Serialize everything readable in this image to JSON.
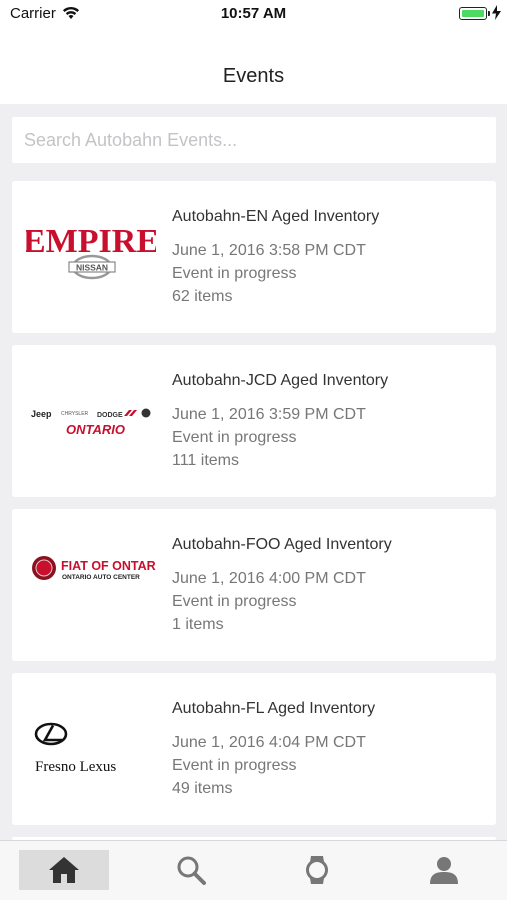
{
  "status": {
    "carrier": "Carrier",
    "time": "10:57 AM"
  },
  "header": {
    "title": "Events"
  },
  "search": {
    "placeholder": "Search Autobahn Events..."
  },
  "events": [
    {
      "title": "Autobahn-EN Aged Inventory",
      "date": "June 1, 2016 3:58 PM CDT",
      "status": "Event in progress",
      "count": "62 items",
      "logo": {
        "icon": "empire-nissan-logo",
        "text": "EMPIRE",
        "subtext": "NISSAN"
      }
    },
    {
      "title": "Autobahn-JCD Aged Inventory",
      "date": "June 1, 2016 3:59 PM CDT",
      "status": "Event in progress",
      "count": "111 items",
      "logo": {
        "icon": "jeep-chrysler-dodge-ram-ontario-logo",
        "text": "Jeep",
        "text2": "CHRYSLER",
        "text3": "DODGE",
        "subtext": "ONTARIO"
      }
    },
    {
      "title": "Autobahn-FOO Aged Inventory",
      "date": "June 1, 2016 4:00 PM CDT",
      "status": "Event in progress",
      "count": "1 items",
      "logo": {
        "icon": "fiat-of-ontario-logo",
        "text": "FIAT OF ONTARIO",
        "subtext": "ONTARIO AUTO CENTER"
      }
    },
    {
      "title": "Autobahn-FL Aged Inventory",
      "date": "June 1, 2016 4:04 PM CDT",
      "status": "Event in progress",
      "count": "49 items",
      "logo": {
        "icon": "fresno-lexus-logo",
        "text": "Fresno Lexus"
      }
    }
  ],
  "tabs": [
    {
      "name": "home",
      "icon": "home-icon",
      "active": true
    },
    {
      "name": "search",
      "icon": "search-icon",
      "active": false
    },
    {
      "name": "watch",
      "icon": "watch-icon",
      "active": false
    },
    {
      "name": "profile",
      "icon": "profile-icon",
      "active": false
    }
  ],
  "colors": {
    "brand_red": "#c8102e",
    "background": "#efeff2",
    "tab_active": "#dcdcdc"
  }
}
